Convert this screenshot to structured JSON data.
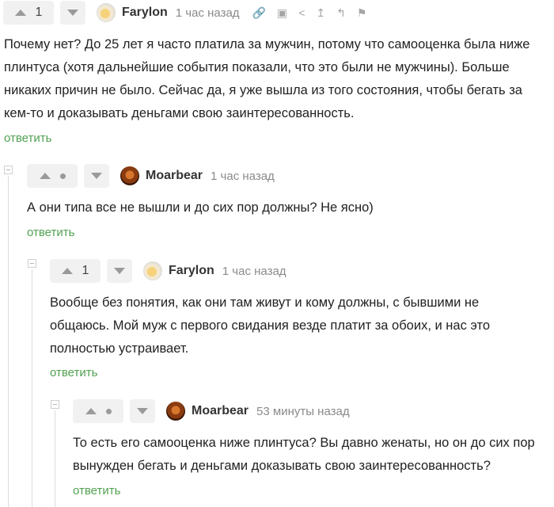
{
  "comments": [
    {
      "rating": "1",
      "author": "Farylon",
      "time": "1 час назад",
      "text": "Почему нет? До 25 лет я часто платила за мужчин, потому что самооценка была ниже плинтуса (хотя дальнейшие события показали, что это были не мужчины). Больше никаких причин не было. Сейчас да, я уже вышла из того состояния, чтобы бегать за кем-то и доказывать деньгами свою заинтересованность.",
      "reply": "ответить"
    },
    {
      "rating": "",
      "author": "Moarbear",
      "time": "1 час назад",
      "text": "А они типа все не вышли и до сих пор должны? Не ясно)",
      "reply": "ответить"
    },
    {
      "rating": "1",
      "author": "Farylon",
      "time": "1 час назад",
      "text": "Вообще без понятия, как они там живут и кому должны, с бывшими не общаюсь. Мой муж с первого свидания везде платит за обоих, и нас это полностью устраивает.",
      "reply": "ответить"
    },
    {
      "rating": "",
      "author": "Moarbear",
      "time": "53 минуты назад",
      "text": "То есть его самооценка ниже плинтуса? Вы давно женаты, но он до сих пор вынужден бегать и деньгами доказывать свою заинтересованность?",
      "reply": "ответить"
    }
  ],
  "tools": [
    "link-icon",
    "save-icon",
    "share-icon",
    "go-to-parent-icon",
    "branch-icon",
    "report-flag-icon"
  ],
  "colors": {
    "reply_link": "#52a152",
    "vote_bg": "#f1f1f1",
    "muted": "#8a8a8a"
  }
}
